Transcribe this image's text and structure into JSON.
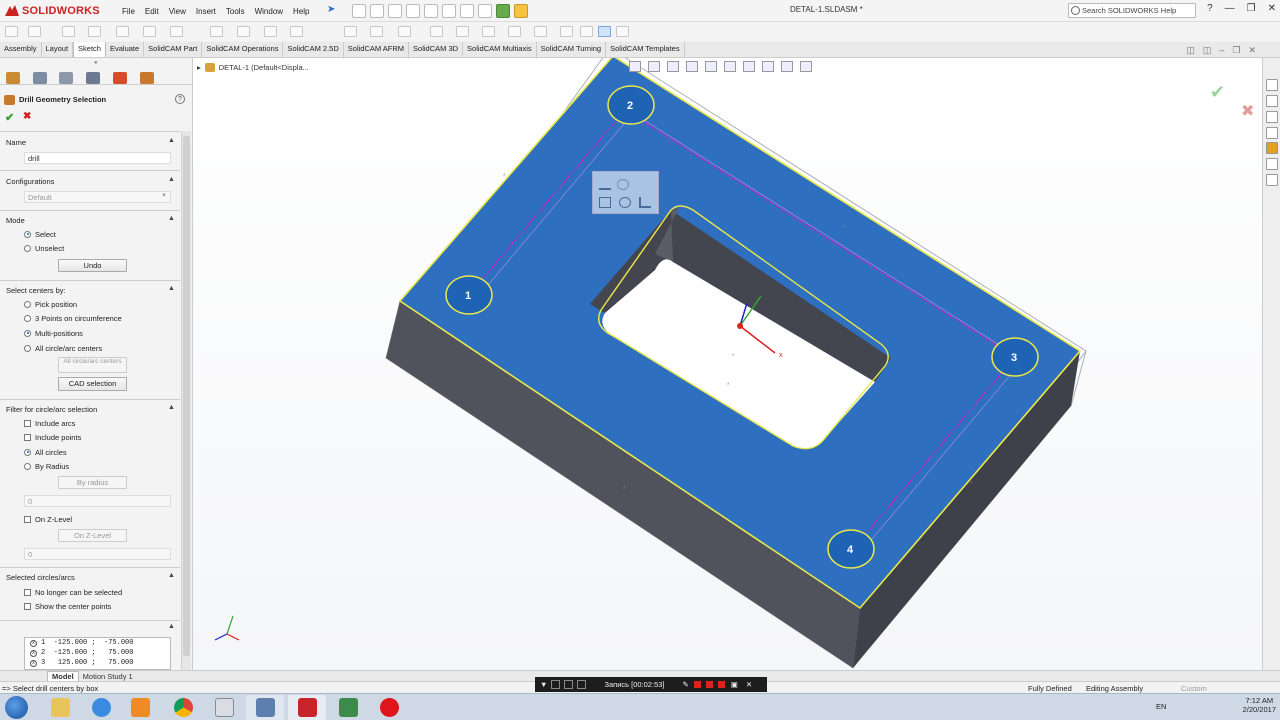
{
  "app": {
    "brand": "SOLIDWORKS",
    "doc_title": "DETAL-1.SLDASM *",
    "help_search_placeholder": "Search SOLIDWORKS Help",
    "menu": [
      "File",
      "Edit",
      "View",
      "Insert",
      "Tools",
      "Window",
      "Help"
    ]
  },
  "tabs": [
    "Assembly",
    "Layout",
    "Sketch",
    "Evaluate",
    "SolidCAM Part",
    "SolidCAM Operations",
    "SolidCAM 2.5D",
    "SolidCAM AFRM",
    "SolidCAM 3D",
    "SolidCAM Multiaxis",
    "SolidCAM Turning",
    "SolidCAM Templates"
  ],
  "active_tab": "Sketch",
  "panel": {
    "title": "Drill Geometry Selection",
    "name_label": "Name",
    "name_value": "drill",
    "configurations_label": "Configurations",
    "configurations_value": "Default",
    "mode_label": "Mode",
    "mode_select": "Select",
    "mode_unselect": "Unselect",
    "undo_label": "Undo",
    "select_centers_label": "Select centers by:",
    "pick_position": "Pick position",
    "three_points": "3 Points on circumference",
    "multi_positions": "Multi-positions",
    "all_circle_centers": "All circle/arc centers",
    "all_circle_button": "All circle/arc centers",
    "cad_selection": "CAD selection",
    "filter_label": "Filter for circle/arc selection",
    "include_arcs": "Include arcs",
    "include_points": "Include points",
    "all_circles": "All circles",
    "by_radius": "By Radius",
    "by_radius_button": "By radius",
    "radius_value": "0",
    "on_z_level": "On Z-Level",
    "on_z_level_button": "On Z-Level",
    "z_value": "0",
    "selected_label": "Selected circles/arcs",
    "no_longer_selected": "No longer can be selected",
    "show_center_points": "Show the center points",
    "selected_rows": [
      {
        "n": "1",
        "x": "-125.000 ;",
        "y": "-75.000"
      },
      {
        "n": "2",
        "x": "-125.000 ;",
        "y": "75.000"
      },
      {
        "n": "3",
        "x": "125.000 ;",
        "y": "75.000"
      }
    ]
  },
  "tree": {
    "root": "DETAL-1  (Default<Displa..."
  },
  "drill_points": [
    "1",
    "2",
    "3",
    "4"
  ],
  "bottom_tabs": [
    "Model",
    "Motion Study 1"
  ],
  "status": {
    "prompt": "=> Select drill centers by box",
    "fully_defined": "Fully Defined",
    "editing": "Editing Assembly",
    "custom": "Custom"
  },
  "recorder": {
    "text": "Запись [00:02:53]"
  },
  "taskbar": {
    "lang": "EN",
    "time": "7:12 AM",
    "date": "2/20/2017"
  },
  "colors": {
    "face": "#2f6fc0",
    "wall": "#4b4d57",
    "edge": "#e8e84a",
    "path": "#d21ed2"
  }
}
